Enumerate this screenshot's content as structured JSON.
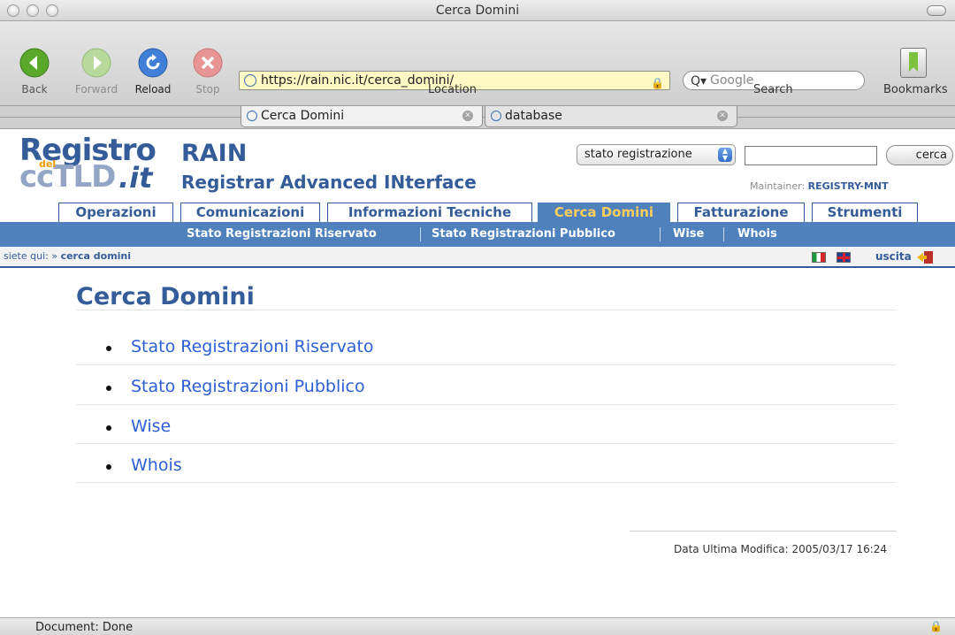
{
  "window": {
    "title": "Cerca Domini"
  },
  "toolbar": {
    "back_label": "Back",
    "forward_label": "Forward",
    "reload_label": "Reload",
    "stop_label": "Stop",
    "location_label": "Location",
    "url": "https://rain.nic.it/cerca_domini/",
    "search_label": "Search",
    "search_placeholder": "Google",
    "bookmarks_label": "Bookmarks"
  },
  "browser_tabs": [
    {
      "label": "Cerca Domini"
    },
    {
      "label": "database"
    }
  ],
  "header": {
    "logo_line1": "Registro",
    "logo_del": "del",
    "logo_line2": "ccTLD",
    "logo_tld": ".it",
    "title": "RAIN",
    "subtitle": "Registrar Advanced INterface",
    "select_value": "stato registrazione",
    "search_button": "cerca",
    "maintainer_label": "Maintainer:",
    "maintainer_value": "REGISTRY-MNT"
  },
  "main_tabs": [
    {
      "label": "Operazioni"
    },
    {
      "label": "Comunicazioni"
    },
    {
      "label": "Informazioni Tecniche"
    },
    {
      "label": "Cerca Domini",
      "active": true
    },
    {
      "label": "Fatturazione"
    },
    {
      "label": "Strumenti"
    }
  ],
  "subnav": [
    {
      "label": "Stato Registrazioni Riservato"
    },
    {
      "label": "Stato Registrazioni Pubblico"
    },
    {
      "label": "Wise"
    },
    {
      "label": "Whois"
    }
  ],
  "breadcrumb": {
    "prefix": "siete qui: »",
    "current": "cerca domini"
  },
  "logout_label": "uscita",
  "page": {
    "title": "Cerca Domini",
    "links": [
      {
        "label": "Stato Registrazioni Riservato"
      },
      {
        "label": "Stato Registrazioni Pubblico"
      },
      {
        "label": "Wise"
      },
      {
        "label": "Whois"
      }
    ]
  },
  "footer": {
    "last_modified": "Data Ultima Modifica: 2005/03/17 16:24"
  },
  "status": {
    "text": "Document: Done"
  },
  "colors": {
    "brand": "#335c99",
    "nav": "#4f81bd",
    "active_tab_text": "#ffce5c",
    "link": "#2c5fd6"
  }
}
